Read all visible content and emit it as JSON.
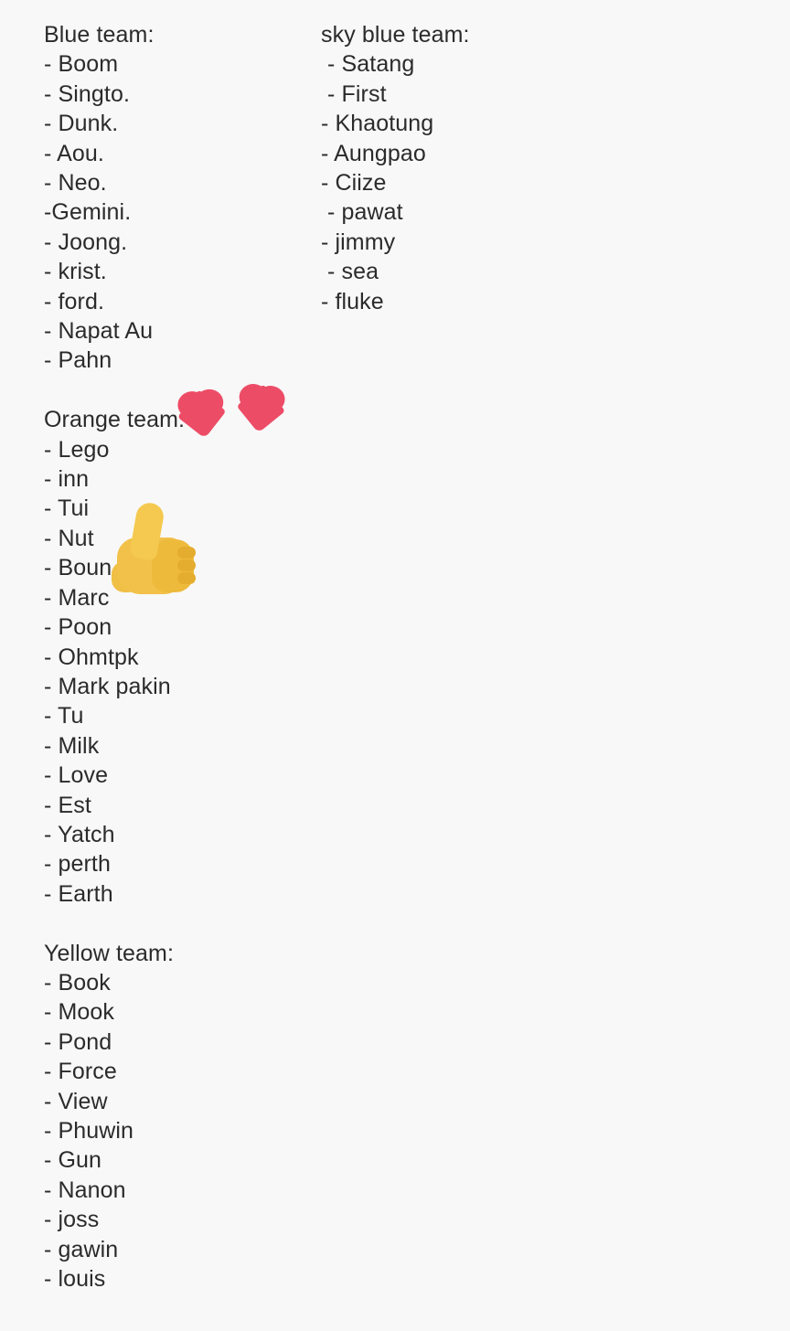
{
  "document": {
    "background_color": "#f8f8f8",
    "text_color": "#2b2b2b",
    "columns": {
      "left": {
        "sections": [
          {
            "heading": "Blue team:",
            "items": [
              "- Boom",
              "- Singto.",
              "- Dunk.",
              "- Aou.",
              "- Neo.",
              "-Gemini.",
              "- Joong.",
              "- krist.",
              "- ford.",
              "- Napat Au",
              "- Pahn"
            ]
          },
          {
            "heading": "Orange team:",
            "items": [
              "- Lego",
              "- inn",
              "- Tui",
              "- Nut",
              "- Boun",
              "- Marc",
              "- Poon",
              "- Ohmtpk",
              "- Mark pakin",
              "- Tu",
              "- Milk",
              "- Love",
              "- Est",
              "- Yatch",
              "- perth",
              "- Earth"
            ]
          },
          {
            "heading": "Yellow team:",
            "items": [
              "- Book",
              "- Mook",
              "- Pond",
              "- Force",
              "- View",
              "- Phuwin",
              "- Gun",
              "- Nanon",
              "- joss",
              "- gawin",
              "- louis"
            ]
          }
        ]
      },
      "right": {
        "sections": [
          {
            "heading": "sky blue team:",
            "items": [
              " - Satang",
              " - First",
              "- Khaotung",
              "- Aungpao",
              "- Ciize",
              " - pawat",
              "- jimmy",
              " - sea",
              "- fluke"
            ]
          }
        ]
      }
    },
    "emojis": [
      {
        "name": "red-heart-emoji",
        "glyph": "heart",
        "color": "#ed4c67",
        "shadow_color": "#c9394f",
        "count": 2,
        "near_text": "Orange team:"
      },
      {
        "name": "thumbs-up-emoji",
        "glyph": "thumbs-up",
        "color": "#f2c14a",
        "count": 1,
        "near_text": "- Boun"
      }
    ]
  }
}
